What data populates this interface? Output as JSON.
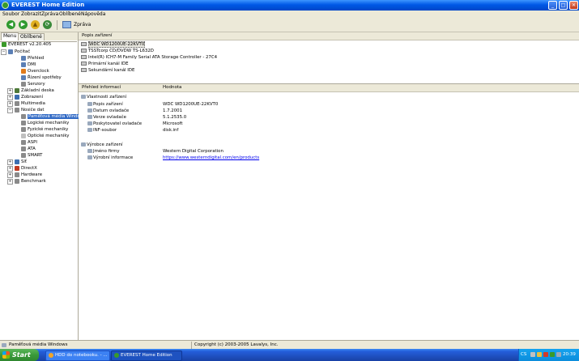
{
  "window": {
    "title": "EVEREST Home Edition"
  },
  "menu": [
    "Soubor",
    "Zobrazit",
    "Zpráva",
    "Oblíbené",
    "Nápověda"
  ],
  "toolbar": {
    "report_label": "Zpráva"
  },
  "tabs": [
    "Menu",
    "Oblíbené"
  ],
  "tree": [
    {
      "label": "EVEREST v2.20.405",
      "icon": "everest-icon",
      "color": "#3a9a2a"
    },
    {
      "label": "Počítač",
      "icon": "computer-icon",
      "color": "#5b7fb5"
    },
    {
      "label": "Přehled",
      "icon": "info-icon",
      "color": "#5b7fb5"
    },
    {
      "label": "DMI",
      "icon": "info-icon",
      "color": "#5b7fb5"
    },
    {
      "label": "Overclock",
      "icon": "overclock-icon",
      "color": "#e07b1a"
    },
    {
      "label": "Řízení spotřeby",
      "icon": "power-icon",
      "color": "#5b7fb5"
    },
    {
      "label": "Senzory",
      "icon": "sensor-icon",
      "color": "#8a8a8a"
    },
    {
      "label": "Základní deska",
      "icon": "motherboard-icon",
      "color": "#4f7a3a"
    },
    {
      "label": "Zobrazení",
      "icon": "display-icon",
      "color": "#3d6fb0"
    },
    {
      "label": "Multimedia",
      "icon": "multimedia-icon",
      "color": "#8a8a8a"
    },
    {
      "label": "Nosiče dat",
      "icon": "storage-icon",
      "color": "#8a8a8a"
    },
    {
      "label": "Paměťová média Windows",
      "icon": "disk-icon",
      "color": "#8a8a8a"
    },
    {
      "label": "Logické mechaniky",
      "icon": "disk-icon",
      "color": "#8a8a8a"
    },
    {
      "label": "Fyzické mechaniky",
      "icon": "disk-icon",
      "color": "#8a8a8a"
    },
    {
      "label": "Optické mechaniky",
      "icon": "optical-icon",
      "color": "#c0c0c0"
    },
    {
      "label": "ASPI",
      "icon": "aspi-icon",
      "color": "#8a8a8a"
    },
    {
      "label": "ATA",
      "icon": "ata-icon",
      "color": "#8a8a8a"
    },
    {
      "label": "SMART",
      "icon": "smart-icon",
      "color": "#8a8a8a"
    },
    {
      "label": "Síť",
      "icon": "network-icon",
      "color": "#3d6fb0"
    },
    {
      "label": "DirectX",
      "icon": "directx-icon",
      "color": "#c23b22"
    },
    {
      "label": "Hardware",
      "icon": "hardware-icon",
      "color": "#8a8a8a"
    },
    {
      "label": "Benchmark",
      "icon": "benchmark-icon",
      "color": "#8a8a8a"
    }
  ],
  "devices_header": "Popis zařízení",
  "devices": [
    "WDC WD1200UE-22KVT0",
    "TSSTcorp CD/DVDW TS-L632D",
    "Intel(R) ICH7-M Family Serial ATA Storage Controller - 27C4",
    "Primární kanál IDE",
    "Sekundární kanál IDE"
  ],
  "details_header": {
    "col1": "Přehled informací",
    "col2": "Hodnota"
  },
  "details": {
    "group1": "Vlastnosti zařízení",
    "rows1": [
      {
        "key": "Popis zařízení",
        "value": "WDC WD1200UE-22KVT0"
      },
      {
        "key": "Datum ovladače",
        "value": "1.7.2001"
      },
      {
        "key": "Verze ovladače",
        "value": "5.1.2535.0"
      },
      {
        "key": "Poskytovatel ovladače",
        "value": "Microsoft"
      },
      {
        "key": "INF-soubor",
        "value": "disk.inf"
      }
    ],
    "group2": "Výrobce zařízení",
    "rows2": [
      {
        "key": "Jméno firmy",
        "value": "Western Digital Corporation"
      },
      {
        "key": "Výrobní informace",
        "value": "https://www.westerndigital.com/en/products"
      }
    ]
  },
  "status": {
    "left": "Paměťová média Windows",
    "right": "Copyright (c) 2003-2005 Lavalys, Inc."
  },
  "taskbar": {
    "start": "Start",
    "tasks": [
      "HDD do notebooku. - ...",
      "EVEREST Home Edition"
    ],
    "lang": "CS",
    "clock": "20:39"
  }
}
